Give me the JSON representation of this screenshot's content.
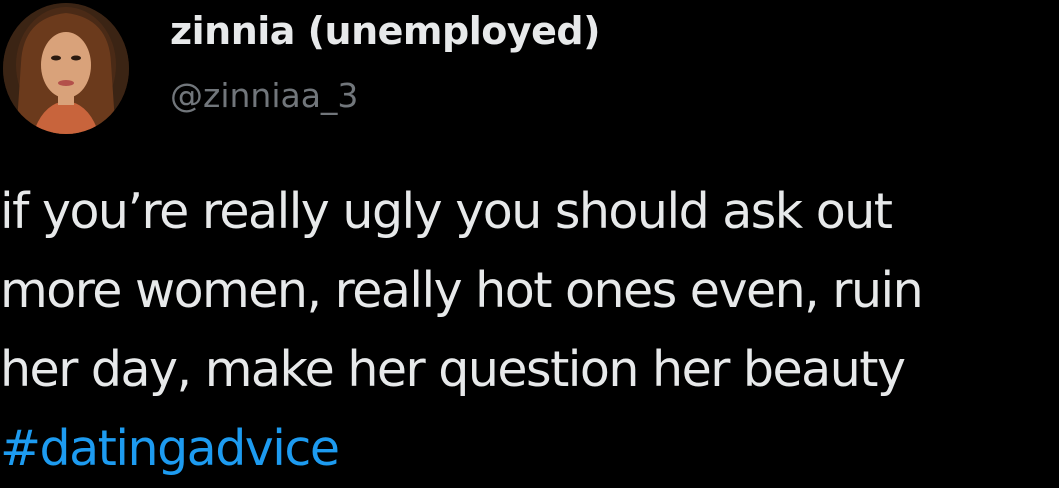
{
  "tweet": {
    "author": {
      "display_name": "zinnia (unemployed)",
      "handle": "@zinniaa_3",
      "avatar_icon": "profile-photo"
    },
    "text_lines": [
      "if you’re really ugly you should ask out",
      "more women, really hot ones even, ruin",
      "her day, make her question her beauty"
    ],
    "hashtag": "#datingadvice"
  },
  "colors": {
    "background": "#000000",
    "text": "#e7e9ea",
    "secondary_text": "#71767b",
    "link": "#1d9bf0"
  }
}
